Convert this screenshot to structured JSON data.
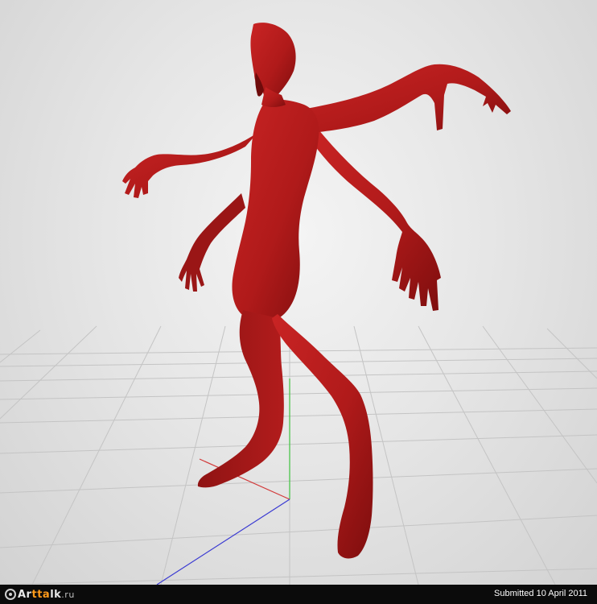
{
  "viewport": {
    "background_center": "#f4f4f4",
    "background_edge": "#d2d2d2",
    "grid_color": "#c4c4c4",
    "axis_colors": {
      "x": "#d23a3a",
      "y": "#3ec23e",
      "z": "#3a3ad2"
    },
    "model_color": "#b51d1d"
  },
  "footer": {
    "logo": {
      "prefix": "Ar",
      "highlight": "tta",
      "name": "lk",
      "domain": ".ru"
    },
    "submitted": "Submitted 10 April 2011"
  }
}
